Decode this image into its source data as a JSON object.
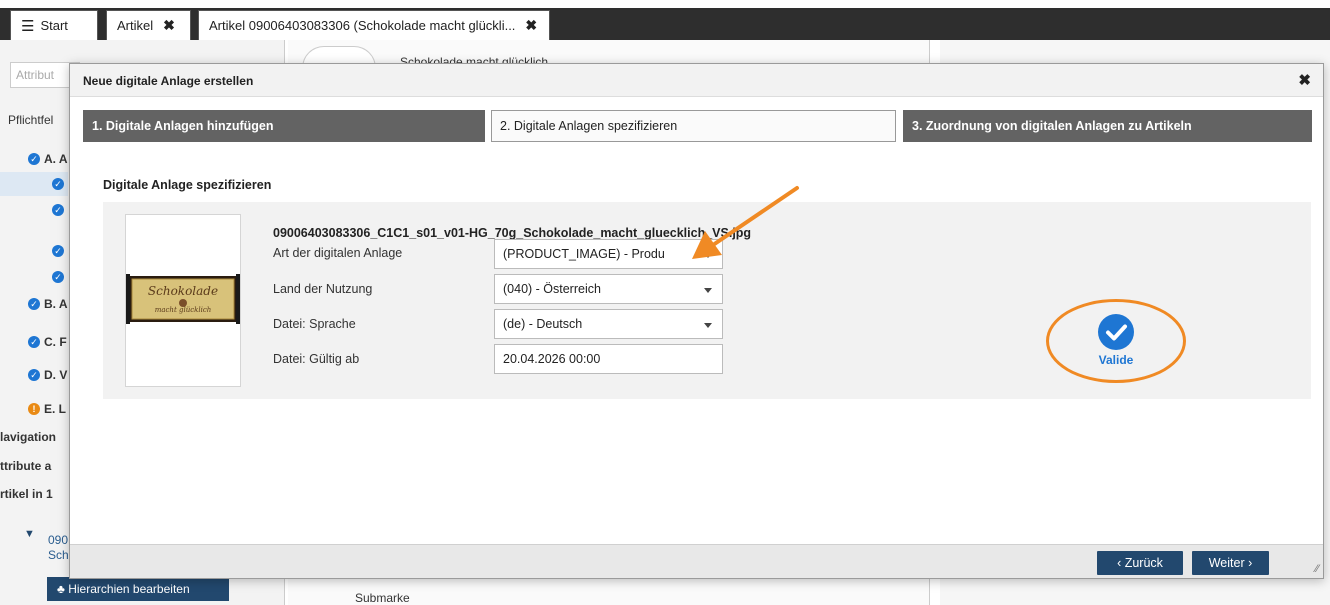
{
  "tabs": [
    {
      "label": "Start"
    },
    {
      "label": "Artikel"
    },
    {
      "label": "Artikel 09006403083306 (Schokolade macht glückli..."
    }
  ],
  "background": {
    "attribute_placeholder": "Attribut",
    "pflichtfelder": "Pflichtfel",
    "tree": [
      "A. A",
      "B. A",
      "C. F",
      "D. V",
      "E. L"
    ],
    "navigation": "lavigation",
    "attribute_a": "ttribute a",
    "artikel_in": "rtikel in 1",
    "product_number": "090",
    "product_short": "Sch",
    "hierarchy_button": "Hierarchien bearbeiten",
    "product_title": "Schokolade macht glücklich",
    "submarke": "Submarke"
  },
  "modal": {
    "title": "Neue digitale Anlage erstellen",
    "steps": [
      "1. Digitale Anlagen hinzufügen",
      "2. Digitale Anlagen spezifizieren",
      "3. Zuordnung von digitalen Anlagen zu Artikeln"
    ],
    "section_title": "Digitale Anlage spezifizieren",
    "filename": "09006403083306_C1C1_s01_v01-HG_70g_Schokolade_macht_gluecklich_VS.jpg",
    "fields": {
      "art": {
        "label": "Art der digitalen Anlage",
        "value": "(PRODUCT_IMAGE) - Produ"
      },
      "land": {
        "label": "Land der Nutzung",
        "value": "(040) - Österreich"
      },
      "sprache": {
        "label": "Datei: Sprache",
        "value": "(de) - Deutsch"
      },
      "gueltig": {
        "label": "Datei: Gültig ab",
        "value": "20.04.2026 00:00"
      }
    },
    "status": "Valide",
    "buttons": {
      "back": "‹ Zurück",
      "next": "Weiter ›"
    },
    "thumb_text": {
      "line1": "Schokolade",
      "line2": "macht glücklich"
    }
  },
  "colors": {
    "accent": "#1e76d3",
    "button": "#22486e",
    "annotation": "#f08a24",
    "step_active": "#636363"
  }
}
